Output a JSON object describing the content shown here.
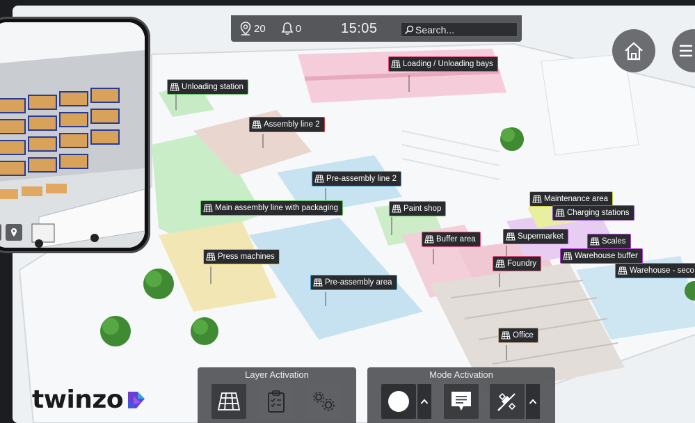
{
  "topbar": {
    "location_count": "20",
    "notification_count": "0",
    "clock": "15:05",
    "search_placeholder": "Search..."
  },
  "map_labels": [
    {
      "text": "Loading / Unloading bays",
      "color": "#e0507a"
    },
    {
      "text": "Unloading station",
      "color": "#5ec25e"
    },
    {
      "text": "Assembly line 2",
      "color": "#d23a3a"
    },
    {
      "text": "Pre-assembly line 2",
      "color": "#3aa0d6"
    },
    {
      "text": "Main assembly line with packaging",
      "color": "#5ec25e"
    },
    {
      "text": "Paint shop",
      "color": "#5ec25e"
    },
    {
      "text": "Maintenance area",
      "color": "#c8d23a"
    },
    {
      "text": "Charging stations",
      "color": "#8a4ad6"
    },
    {
      "text": "Buffer area",
      "color": "#e0507a"
    },
    {
      "text": "Supermarket",
      "color": "#b43ad6"
    },
    {
      "text": "Scales",
      "color": "#b43ad6"
    },
    {
      "text": "Press machines",
      "color": "#d6c23a"
    },
    {
      "text": "Foundry",
      "color": "#e0507a"
    },
    {
      "text": "Warehouse buffer",
      "color": "#b43ad6"
    },
    {
      "text": "Warehouse - seco",
      "color": "#3aa0d6"
    },
    {
      "text": "Pre-assembly area",
      "color": "#3aa0d6"
    },
    {
      "text": "Office",
      "color": "#b9a58f"
    }
  ],
  "layer_panel": {
    "title": "Layer Activation"
  },
  "mode_panel": {
    "title": "Mode Activation"
  },
  "brand": {
    "name": "twinzo"
  },
  "icons": {
    "home": "home-icon",
    "menu": "hamburger-menu-icon",
    "location": "location-pin-icon",
    "bell": "bell-icon",
    "search": "search-icon",
    "area": "area-grid-icon"
  }
}
